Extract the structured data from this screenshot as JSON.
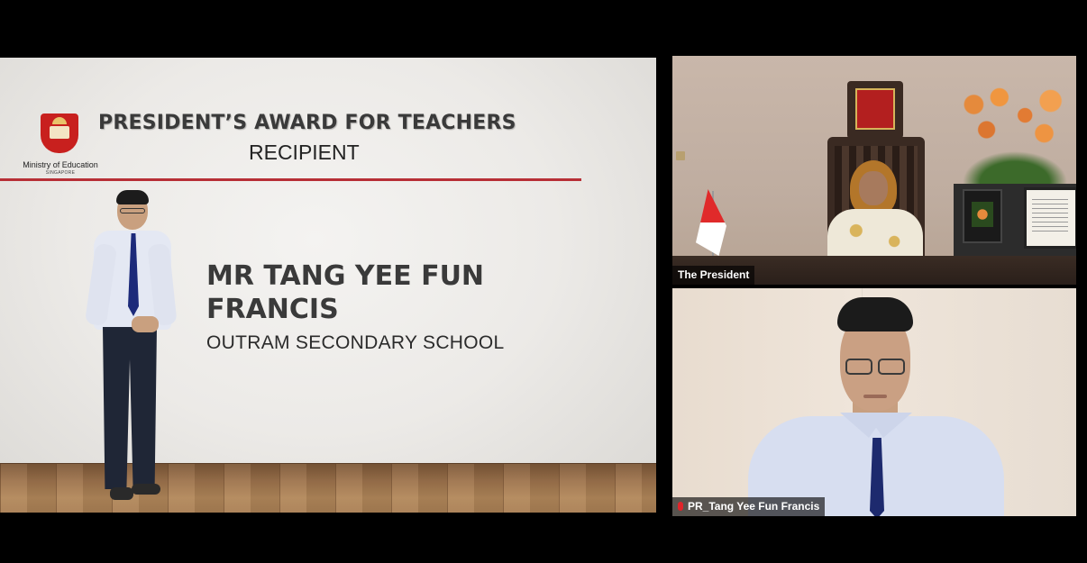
{
  "slide": {
    "logo_name": "Ministry of Education",
    "logo_sub": "SINGAPORE",
    "title": "PRESIDENT’S AWARD FOR TEACHERS",
    "subtitle": "RECIPIENT",
    "recipient_name": "MR TANG YEE FUN FRANCIS",
    "recipient_school": "OUTRAM SECONDARY SCHOOL"
  },
  "participants": [
    {
      "name": "The President"
    },
    {
      "name": "PR_Tang Yee Fun Francis"
    }
  ],
  "colors": {
    "background": "#000000",
    "accent_rule": "#b72f36",
    "name_tag_bg": "#000000",
    "mic_muted": "#e0242a"
  }
}
